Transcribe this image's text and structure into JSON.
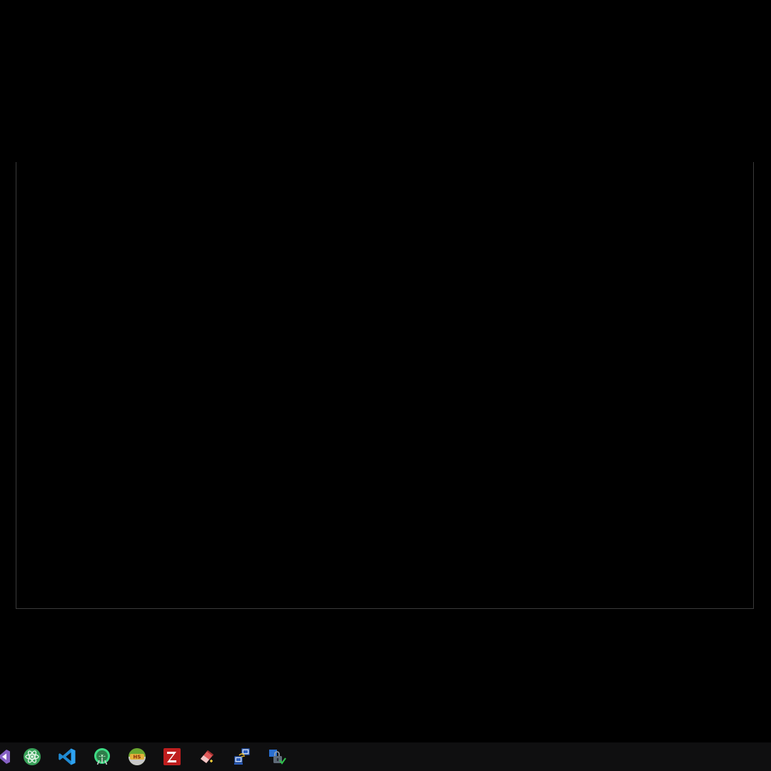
{
  "taskbar": {
    "background": "#0f0f10",
    "apps": [
      {
        "icon": "visual-studio-icon",
        "color": "#8661c5"
      },
      {
        "icon": "atom-editor-icon",
        "color": "#3aa35b"
      },
      {
        "icon": "vscode-icon",
        "color": "#1f8ad2"
      },
      {
        "icon": "android-studio-icon",
        "color": "#4caf50"
      },
      {
        "icon": "heidisql-icon",
        "color": "#6aa630",
        "text": "HS"
      },
      {
        "icon": "filezilla-icon",
        "color": "#bf1e1e"
      },
      {
        "icon": "eraser-tool-icon",
        "color": "#d84a4a"
      },
      {
        "icon": "network-computers-icon",
        "color": "#2a5fc1"
      },
      {
        "icon": "security-lock-icon",
        "color": "#2a6fd0"
      }
    ]
  }
}
